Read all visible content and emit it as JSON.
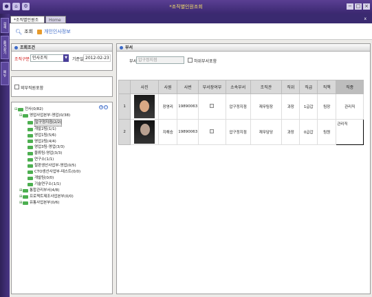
{
  "window": {
    "title": "*조직별인원조회"
  },
  "leftnav": [
    "검색",
    "즐겨찾기",
    "메뉴"
  ],
  "tabs": {
    "active": "*조직별인원조회",
    "inactive": "Home",
    "close": "x"
  },
  "toolbar": {
    "search_label": "조회",
    "personal_label": "개인인사정보"
  },
  "criteria": {
    "header": "조회조건",
    "org_label": "조직구분",
    "org_value": "인사조직",
    "date_label": "기준일",
    "date_value": "2012-02-23"
  },
  "include_external": {
    "label": "외부직원포함"
  },
  "dept": {
    "header": "부서",
    "label": "부서",
    "placeholder": "압구정지점",
    "sub_label": "하위부서포함"
  },
  "tree": [
    {
      "level": 0,
      "toggle": "⊟",
      "label": "전사(0/82)"
    },
    {
      "level": 1,
      "toggle": "⊟",
      "label": "영업사업본부-영업(0/38)"
    },
    {
      "level": 2,
      "toggle": "",
      "label": "압구정지점(2/2)",
      "selected": true
    },
    {
      "level": 2,
      "toggle": "",
      "label": "개발2팀(1/1)"
    },
    {
      "level": 2,
      "toggle": "",
      "label": "영업1팀(5/6)"
    },
    {
      "level": 2,
      "toggle": "",
      "label": "영업2팀(4/4)"
    },
    {
      "level": 2,
      "toggle": "",
      "label": "영업3팀-영업(3/3)"
    },
    {
      "level": 2,
      "toggle": "",
      "label": "물류팀-영업(3/3)"
    },
    {
      "level": 2,
      "toggle": "",
      "label": "연구소(1/1)"
    },
    {
      "level": 2,
      "toggle": "",
      "label": "철판생산사업부-영업(0/5)"
    },
    {
      "level": 2,
      "toggle": "",
      "label": "CTO생산사업부-테스트(0/0)"
    },
    {
      "level": 2,
      "toggle": "",
      "label": "개발팀(0/0)"
    },
    {
      "level": 2,
      "toggle": "",
      "label": "기술연구소(1/1)"
    },
    {
      "level": 1,
      "toggle": "⊞",
      "label": "통합관리부서(4/8)"
    },
    {
      "level": 1,
      "toggle": "⊞",
      "label": "프로젝트제조사업본부(0/0)"
    },
    {
      "level": 1,
      "toggle": "⊞",
      "label": "유통사업본부(0/6)"
    }
  ],
  "grid": {
    "columns": [
      "사진",
      "사원",
      "사번",
      "부서장여부",
      "소속부서",
      "조직관",
      "직위",
      "직급",
      "직책",
      "직종"
    ],
    "rows": [
      {
        "no": "1",
        "name": "장영리",
        "id": "19890063",
        "dept": "압구정지점",
        "org": "재무팀장",
        "rank": "과장",
        "grade": "1급갑",
        "title": "팀장",
        "job": "관리직"
      },
      {
        "no": "2",
        "name": "지해승",
        "id": "19890063",
        "dept": "압구정지점",
        "org": "재무담당",
        "rank": "과장",
        "grade": "0급갑",
        "title": "팀원",
        "job": "관리직"
      }
    ]
  }
}
